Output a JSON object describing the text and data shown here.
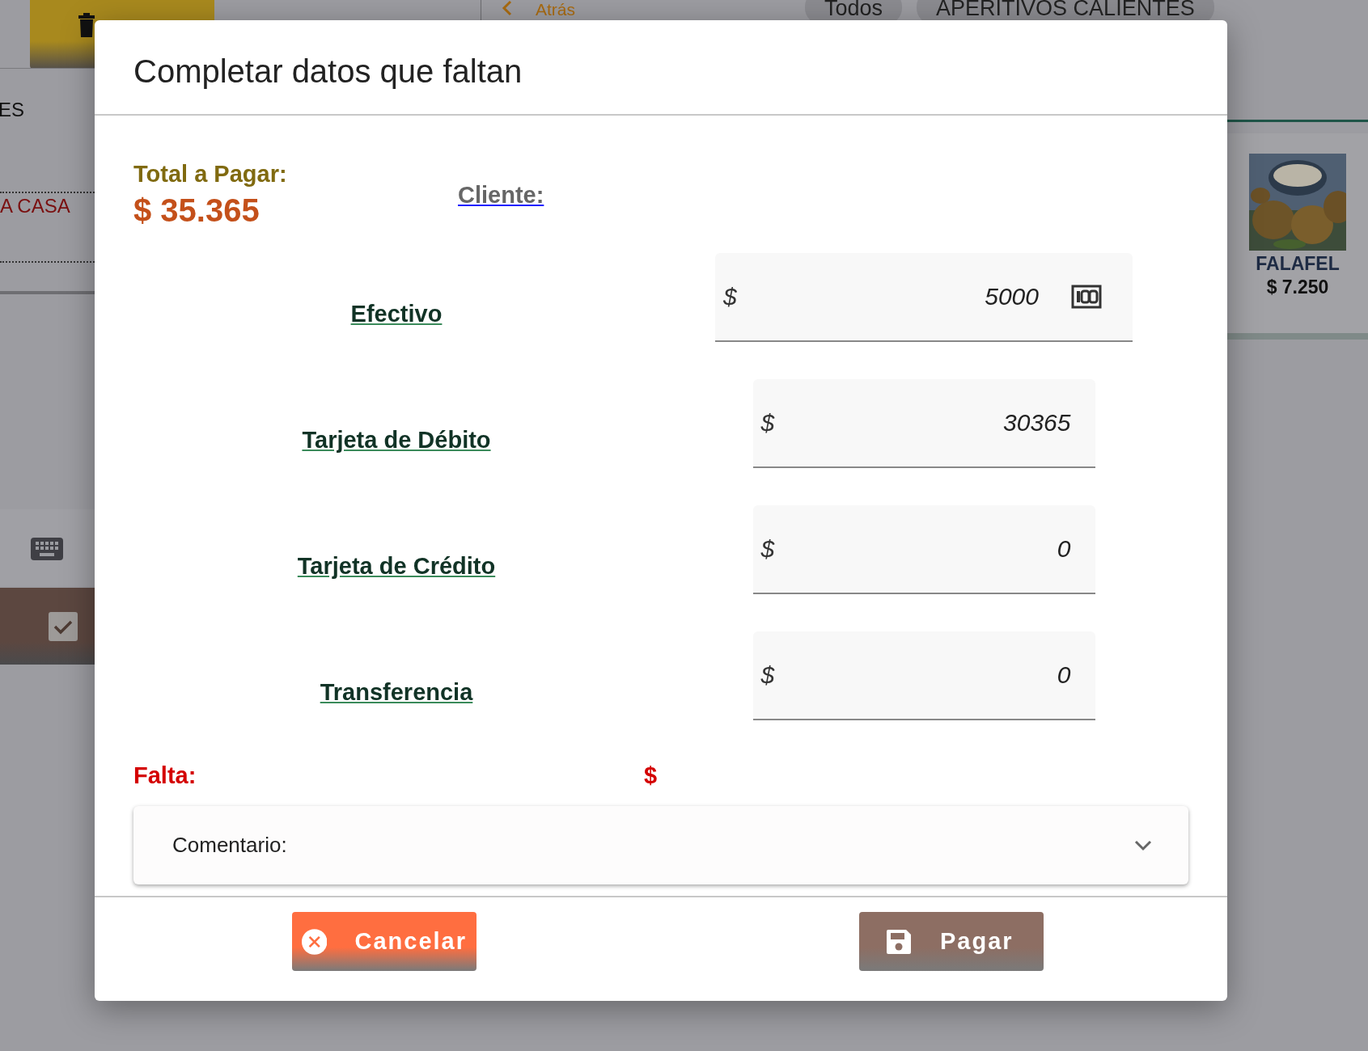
{
  "background": {
    "toolbar": {
      "back_label": "Atrás",
      "chips": [
        {
          "label": "Todos"
        },
        {
          "label": "APERITIVOS CALIENTES"
        }
      ]
    },
    "order_panel": {
      "text_1": "ES",
      "text_2": "A CASA",
      "checked": true
    },
    "product": {
      "name": "FALAFEL",
      "price": "$ 7.250"
    }
  },
  "dialog": {
    "title": "Completar datos que faltan",
    "total_label": "Total a Pagar:",
    "total_amount": "$ 35.365",
    "client_link": "Cliente:",
    "payments": [
      {
        "method": "Efectivo",
        "currency": "$",
        "value": "5000",
        "bill_icon": true
      },
      {
        "method": "Tarjeta de Débito",
        "currency": "$",
        "value": "30365",
        "bill_icon": false
      },
      {
        "method": "Tarjeta de Crédito",
        "currency": "$",
        "value": "0",
        "bill_icon": false
      },
      {
        "method": "Transferencia",
        "currency": "$",
        "value": "0",
        "bill_icon": false
      }
    ],
    "missing_label": "Falta:",
    "missing_currency": "$",
    "comment": {
      "label": "Comentario:",
      "expanded": false
    },
    "buttons": [
      {
        "label": "Cancelar",
        "kind": "cancel"
      },
      {
        "label": "Pagar",
        "kind": "pay"
      }
    ]
  }
}
